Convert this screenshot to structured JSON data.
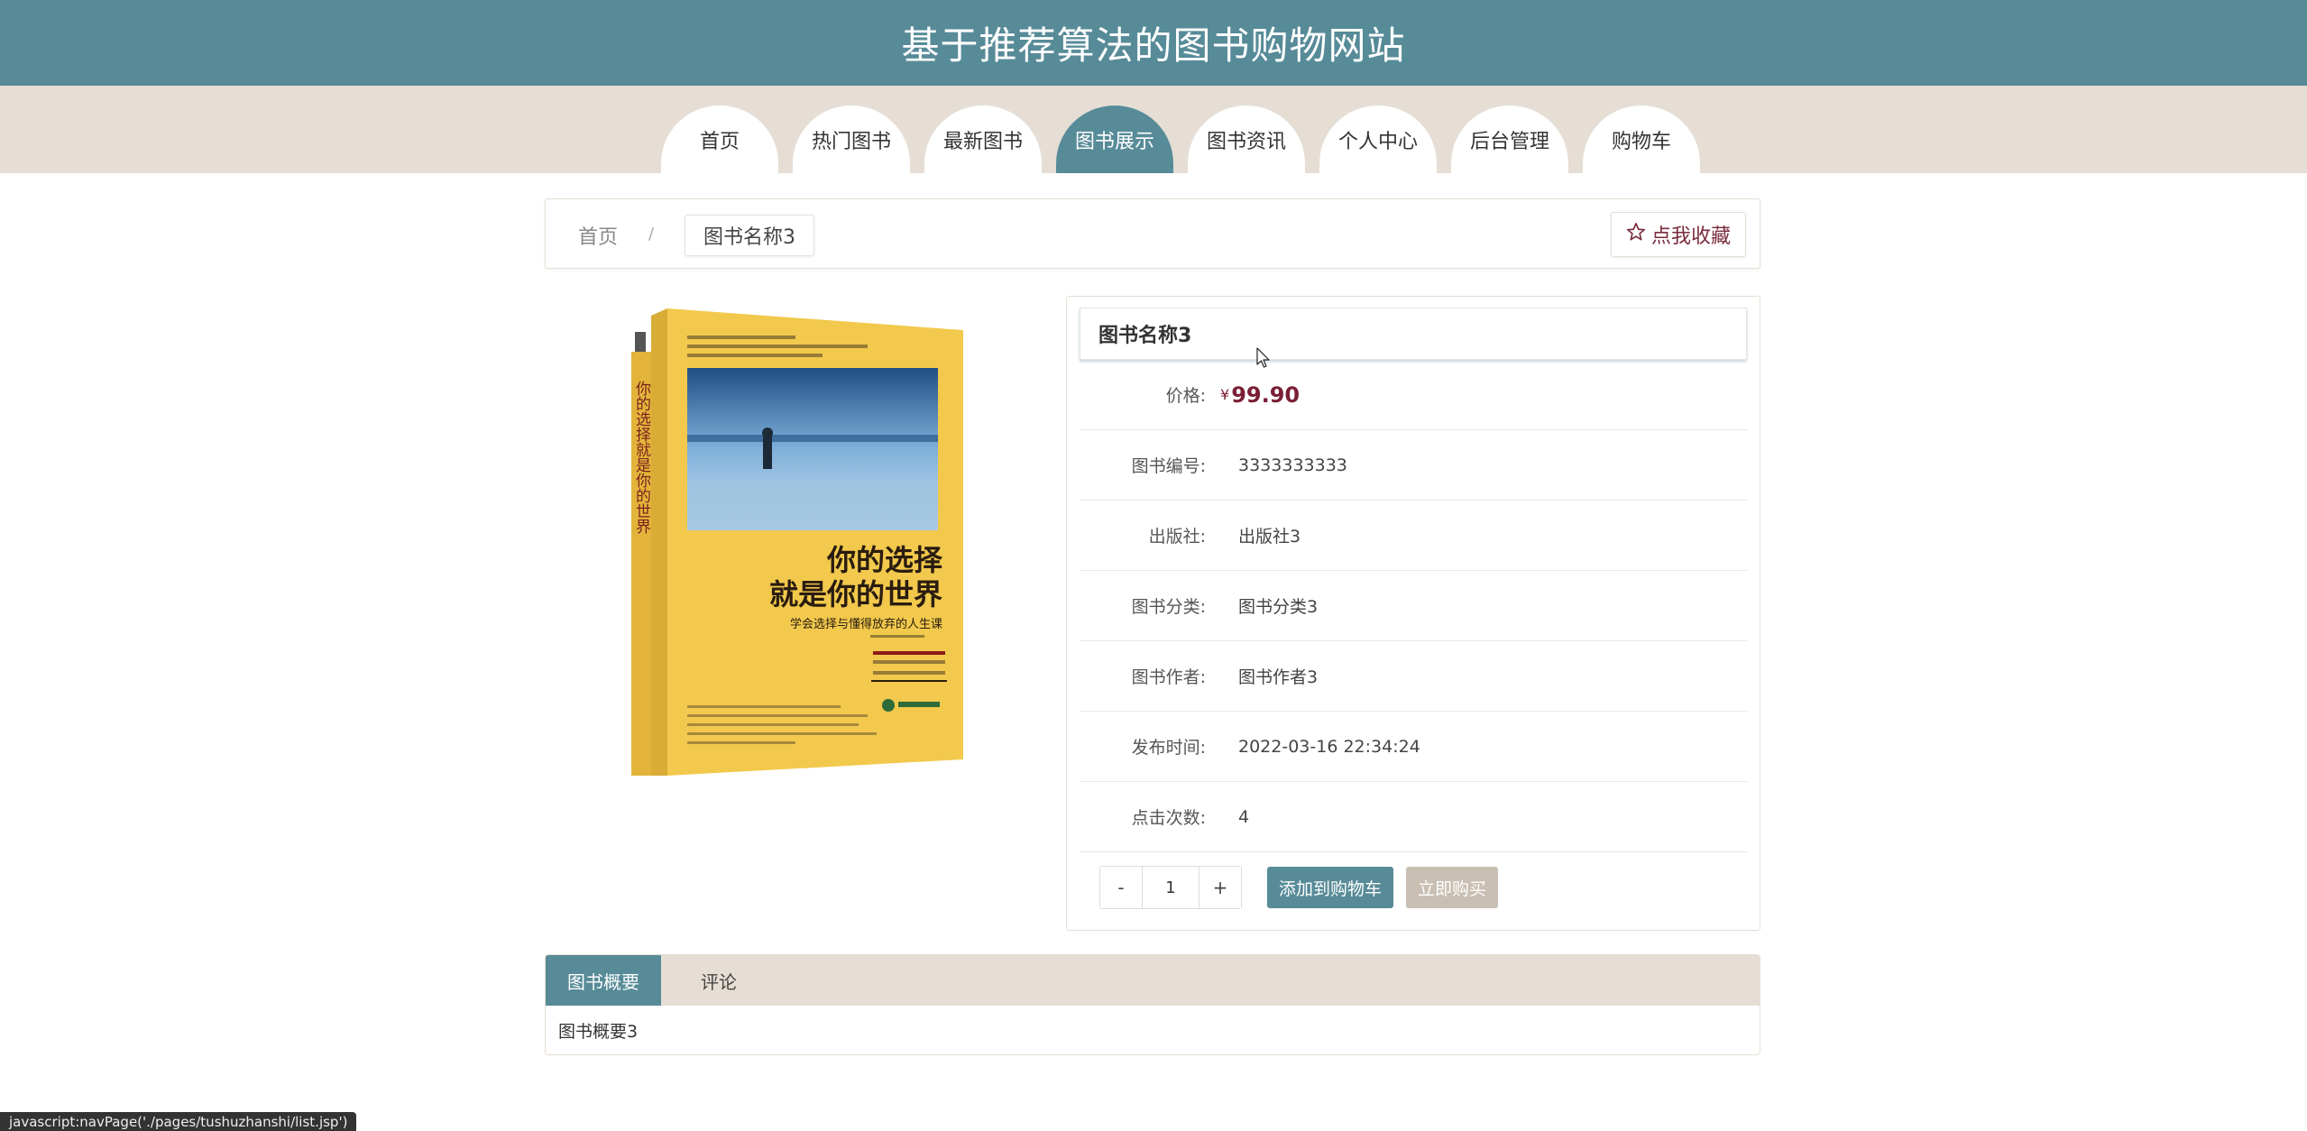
{
  "header": {
    "title": "基于推荐算法的图书购物网站"
  },
  "nav": {
    "items": [
      {
        "label": "首页"
      },
      {
        "label": "热门图书"
      },
      {
        "label": "最新图书"
      },
      {
        "label": "图书展示",
        "active": true
      },
      {
        "label": "图书资讯"
      },
      {
        "label": "个人中心"
      },
      {
        "label": "后台管理"
      },
      {
        "label": "购物车"
      }
    ]
  },
  "breadcrumb": {
    "home": "首页",
    "separator": "/",
    "current": "图书名称3",
    "favorite_label": "点我收藏"
  },
  "book": {
    "title": "图书名称3",
    "price_label": "价格:",
    "price_symbol": "¥",
    "price": "99.90",
    "rows": [
      {
        "label": "图书编号:",
        "value": "3333333333"
      },
      {
        "label": "出版社:",
        "value": "出版社3"
      },
      {
        "label": "图书分类:",
        "value": "图书分类3"
      },
      {
        "label": "图书作者:",
        "value": "图书作者3"
      },
      {
        "label": "发布时间:",
        "value": "2022-03-16 22:34:24"
      },
      {
        "label": "点击次数:",
        "value": "4"
      }
    ],
    "cover": {
      "spine_title": "你的选择就是你的世界",
      "main_title_line1": "你的选择",
      "main_title_line2": "就是你的世界",
      "subtitle": "学会选择与懂得放弃的人生课"
    }
  },
  "cart_actions": {
    "decrement": "-",
    "quantity": "1",
    "increment": "+",
    "add_to_cart": "添加到购物车",
    "buy_now": "立即购买"
  },
  "tabs": {
    "items": [
      {
        "label": "图书概要",
        "active": true
      },
      {
        "label": "评论"
      }
    ],
    "content": "图书概要3"
  },
  "status_bar": {
    "text": "javascript:navPage('./pages/tushuzhanshi/list.jsp')"
  },
  "colors": {
    "primary": "#578b98",
    "beige": "#e6ded4",
    "price": "#7a1f35",
    "cover_yellow": "#f2c94c"
  }
}
